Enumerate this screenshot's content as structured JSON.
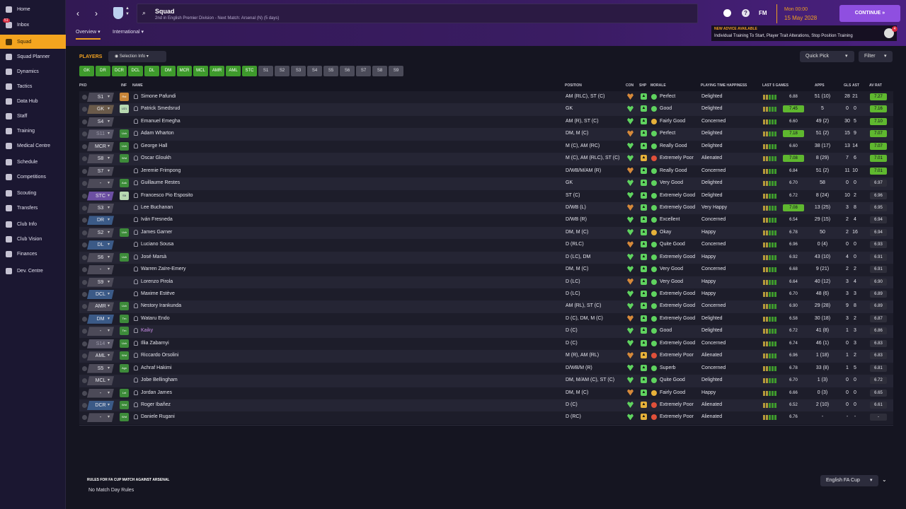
{
  "colors": {
    "accent": "#f0a020",
    "continue": "#8f4fe0",
    "green": "#3e9a2c",
    "sidebar": "#1b1731"
  },
  "sidebar": {
    "items": [
      {
        "label": "Home",
        "icon": "home-icon"
      },
      {
        "label": "Inbox",
        "icon": "inbox-icon",
        "badge": "51"
      },
      {
        "label": "Squad",
        "icon": "squad-icon",
        "active": true
      },
      {
        "label": "Squad Planner",
        "icon": "squad-planner-icon"
      },
      {
        "label": "Dynamics",
        "icon": "dynamics-icon"
      },
      {
        "label": "Tactics",
        "icon": "tactics-icon"
      },
      {
        "label": "Data Hub",
        "icon": "data-hub-icon"
      },
      {
        "label": "Staff",
        "icon": "staff-icon"
      },
      {
        "label": "Training",
        "icon": "training-icon"
      },
      {
        "label": "Medical Centre",
        "icon": "medical-icon"
      },
      {
        "label": "Schedule",
        "icon": "schedule-icon"
      },
      {
        "label": "Competitions",
        "icon": "trophy-icon"
      },
      {
        "label": "Scouting",
        "icon": "scouting-icon"
      },
      {
        "label": "Transfers",
        "icon": "transfers-icon"
      },
      {
        "label": "Club Info",
        "icon": "club-info-icon"
      },
      {
        "label": "Club Vision",
        "icon": "club-vision-icon"
      },
      {
        "label": "Finances",
        "icon": "finances-icon"
      },
      {
        "label": "Dev. Centre",
        "icon": "dev-centre-icon"
      }
    ]
  },
  "header": {
    "title": "Squad",
    "subtitle": "2nd in English Premier Division - Next Match: Arsenal (N) (5 days)",
    "logo": "FM",
    "time": "Mon 00:00",
    "date": "15 May 2028",
    "continue_label": "CONTINUE",
    "advice_title": "NEW ADVICE AVAILABLE",
    "advice_text": "Individual Training To Start, Player Trait Alterations, Stop Position Training",
    "advice_badge": "4"
  },
  "tabs": {
    "overview": "Overview",
    "international": "International"
  },
  "toolbar": {
    "players_label": "PLAYERS",
    "selection_info": "Selection Info",
    "quick_pick": "Quick Pick",
    "filter": "Filter"
  },
  "chips": [
    "GK",
    "DR",
    "DCR",
    "DCL",
    "DL",
    "DM",
    "MCR",
    "MCL",
    "AMR",
    "AML",
    "STC",
    "S1",
    "S2",
    "S3",
    "S4",
    "S5",
    "S6",
    "S7",
    "S8",
    "S9"
  ],
  "columns": {
    "pkd": "PKD",
    "inf": "INF",
    "name": "NAME",
    "position": "POSITION",
    "con": "CON",
    "shp": "SHP",
    "morale": "MORALE",
    "playing_time_happiness": "PLAYING TIME HAPPINESS",
    "last5": "LAST 5 GAMES",
    "apps": "APPS",
    "gls": "GLS",
    "ast": "AST",
    "avrat": "AV RAT"
  },
  "players": [
    {
      "pos": "S1",
      "inf": "Rst",
      "name": "Simone Pafundi",
      "position": "AM (RLC), ST (C)",
      "morale": "Perfect",
      "happiness": "Delighted",
      "last5": "6.88",
      "apps": "51 (10)",
      "gls": "28",
      "ast": "21",
      "avrat": "7.27"
    },
    {
      "pos": "GK",
      "inf": "U21",
      "name": "Patrick Smedsrud",
      "position": "GK",
      "morale": "Good",
      "happiness": "Delighted",
      "last5": "7.45",
      "apps": "5",
      "gls": "0",
      "ast": "0",
      "avrat": "7.16"
    },
    {
      "pos": "S4",
      "inf": "",
      "name": "Emanuel Emegha",
      "position": "AM (R), ST (C)",
      "morale": "Fairly Good",
      "happiness": "Concerned",
      "last5": "6.60",
      "apps": "49 (2)",
      "gls": "30",
      "ast": "5",
      "avrat": "7.10"
    },
    {
      "pos": "S11",
      "inf": "Uch",
      "name": "Adam Wharton",
      "position": "DM, M (C)",
      "morale": "Perfect",
      "happiness": "Delighted",
      "last5": "7.18",
      "apps": "51 (2)",
      "gls": "15",
      "ast": "9",
      "avrat": "7.07"
    },
    {
      "pos": "MCR",
      "inf": "Uch",
      "name": "George Hall",
      "position": "M (C), AM (RC)",
      "morale": "Really Good",
      "happiness": "Delighted",
      "last5": "6.60",
      "apps": "38 (17)",
      "gls": "13",
      "ast": "14",
      "avrat": "7.07"
    },
    {
      "pos": "S8",
      "inf": "Wnt",
      "name": "Oscar Gloukh",
      "position": "M (C), AM (RLC), ST (C)",
      "morale": "Extremely Poor",
      "happiness": "Alienated",
      "last5": "7.08",
      "apps": "8 (29)",
      "gls": "7",
      "ast": "6",
      "avrat": "7.01"
    },
    {
      "pos": "S7",
      "inf": "",
      "name": "Jeremie Frimpong",
      "position": "D/WB/M/AM (R)",
      "morale": "Really Good",
      "happiness": "Concerned",
      "last5": "6.84",
      "apps": "51 (2)",
      "gls": "11",
      "ast": "10",
      "avrat": "7.01"
    },
    {
      "pos": "-",
      "inf": "Aok",
      "name": "Guillaume Restes",
      "position": "GK",
      "morale": "Very Good",
      "happiness": "Delighted",
      "last5": "6.70",
      "apps": "58",
      "gls": "0",
      "ast": "0",
      "avrat": "6.97"
    },
    {
      "pos": "STC",
      "inf": "Slt",
      "name": "Francesco Pio Esposito",
      "position": "ST (C)",
      "morale": "Extremely Good",
      "happiness": "Delighted",
      "last5": "6.72",
      "apps": "8 (24)",
      "gls": "10",
      "ast": "2",
      "avrat": "6.96"
    },
    {
      "pos": "S3",
      "inf": "",
      "name": "Lee Buchanan",
      "position": "D/WB (L)",
      "morale": "Extremely Good",
      "happiness": "Very Happy",
      "last5": "7.08",
      "apps": "13 (25)",
      "gls": "3",
      "ast": "8",
      "avrat": "6.95"
    },
    {
      "pos": "DR",
      "inf": "",
      "name": "Iván Fresneda",
      "position": "D/WB (R)",
      "morale": "Excellent",
      "happiness": "Concerned",
      "last5": "6.54",
      "apps": "29 (15)",
      "gls": "2",
      "ast": "4",
      "avrat": "6.94"
    },
    {
      "pos": "S2",
      "inf": "Uch",
      "name": "James Garner",
      "position": "DM, M (C)",
      "morale": "Okay",
      "happiness": "Happy",
      "last5": "6.78",
      "apps": "50",
      "gls": "2",
      "ast": "16",
      "avrat": "6.94"
    },
    {
      "pos": "DL",
      "inf": "",
      "name": "Luciano Sousa",
      "position": "D (RLC)",
      "morale": "Quite Good",
      "happiness": "Concerned",
      "last5": "6.96",
      "apps": "0 (4)",
      "gls": "0",
      "ast": "0",
      "avrat": "6.93"
    },
    {
      "pos": "S6",
      "inf": "Uch",
      "name": "José Marsà",
      "position": "D (LC), DM",
      "morale": "Extremely Good",
      "happiness": "Happy",
      "last5": "6.92",
      "apps": "43 (10)",
      "gls": "4",
      "ast": "0",
      "avrat": "6.91"
    },
    {
      "pos": "-",
      "inf": "",
      "name": "Warren Zaïre-Emery",
      "position": "DM, M (C)",
      "morale": "Very Good",
      "happiness": "Concerned",
      "last5": "6.68",
      "apps": "9 (21)",
      "gls": "2",
      "ast": "2",
      "avrat": "6.91"
    },
    {
      "pos": "S9",
      "inf": "",
      "name": "Lorenzo Pirola",
      "position": "D (LC)",
      "morale": "Very Good",
      "happiness": "Happy",
      "last5": "6.64",
      "apps": "40 (12)",
      "gls": "3",
      "ast": "4",
      "avrat": "6.90"
    },
    {
      "pos": "DCL",
      "inf": "",
      "name": "Maxime Estève",
      "position": "D (LC)",
      "morale": "Extremely Good",
      "happiness": "Happy",
      "last5": "6.70",
      "apps": "48 (6)",
      "gls": "3",
      "ast": "3",
      "avrat": "6.89"
    },
    {
      "pos": "AMR",
      "inf": "Uch",
      "name": "Nestory Irankunda",
      "position": "AM (RL), ST (C)",
      "morale": "Extremely Good",
      "happiness": "Concerned",
      "last5": "6.90",
      "apps": "29 (28)",
      "gls": "9",
      "ast": "8",
      "avrat": "6.89"
    },
    {
      "pos": "DM",
      "inf": "Trn",
      "name": "Wataru Endo",
      "position": "D (C), DM, M (C)",
      "morale": "Extremely Good",
      "happiness": "Delighted",
      "last5": "6.58",
      "apps": "30 (18)",
      "gls": "3",
      "ast": "2",
      "avrat": "6.87"
    },
    {
      "pos": "-",
      "inf": "Trn",
      "name": "Kaiky",
      "position": "D (C)",
      "morale": "Good",
      "happiness": "Delighted",
      "last5": "6.72",
      "apps": "41 (8)",
      "gls": "1",
      "ast": "3",
      "avrat": "6.86"
    },
    {
      "pos": "S14",
      "inf": "Uch",
      "name": "Illia Zabarnyi",
      "position": "D (C)",
      "morale": "Extremely Good",
      "happiness": "Concerned",
      "last5": "6.74",
      "apps": "46 (1)",
      "gls": "0",
      "ast": "3",
      "avrat": "6.83"
    },
    {
      "pos": "AML",
      "inf": "Wnt",
      "name": "Riccardo Orsolini",
      "position": "M (R), AM (RL)",
      "morale": "Extremely Poor",
      "happiness": "Alienated",
      "last5": "6.96",
      "apps": "1 (18)",
      "gls": "1",
      "ast": "2",
      "avrat": "6.83"
    },
    {
      "pos": "S5",
      "inf": "Agn",
      "name": "Achraf Hakimi",
      "position": "D/WB/M (R)",
      "morale": "Superb",
      "happiness": "Concerned",
      "last5": "6.78",
      "apps": "33 (8)",
      "gls": "1",
      "ast": "5",
      "avrat": "6.81"
    },
    {
      "pos": "MCL",
      "inf": "",
      "name": "Jobe Bellingham",
      "position": "DM, M/AM (C), ST (C)",
      "morale": "Quite Good",
      "happiness": "Delighted",
      "last5": "6.70",
      "apps": "1 (3)",
      "gls": "0",
      "ast": "0",
      "avrat": "6.72"
    },
    {
      "pos": "-",
      "inf": "Lnt",
      "name": "Jordan James",
      "position": "DM, M (C)",
      "morale": "Fairly Good",
      "happiness": "Happy",
      "last5": "6.66",
      "apps": "0 (3)",
      "gls": "0",
      "ast": "0",
      "avrat": "6.65"
    },
    {
      "pos": "DCR",
      "inf": "Wnt",
      "name": "Roger Ibañez",
      "position": "D (C)",
      "morale": "Extremely Poor",
      "happiness": "Alienated",
      "last5": "6.52",
      "apps": "2 (10)",
      "gls": "0",
      "ast": "0",
      "avrat": "6.61"
    },
    {
      "pos": "-",
      "inf": "Wnt",
      "name": "Daniele Rugani",
      "position": "D (RC)",
      "morale": "Extremely Poor",
      "happiness": "Alienated",
      "last5": "6.76",
      "apps": "-",
      "gls": "-",
      "ast": "-",
      "avrat": "-"
    }
  ],
  "footer": {
    "rules_title": "RULES FOR FA CUP MATCH AGAINST ARSENAL",
    "rules_text": "No Match Day Rules",
    "competition": "English FA Cup"
  }
}
